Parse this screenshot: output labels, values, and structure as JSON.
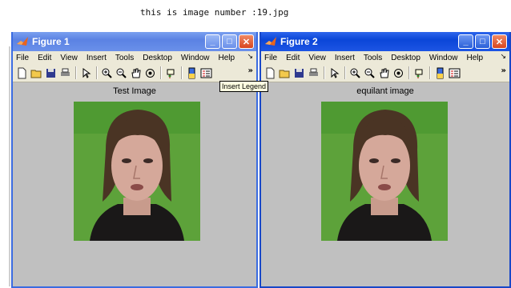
{
  "console": {
    "line": "this is image number :19.jpg"
  },
  "figures": [
    {
      "title": "Figure 1",
      "menus": [
        "File",
        "Edit",
        "View",
        "Insert",
        "Tools",
        "Desktop",
        "Window",
        "Help"
      ],
      "axes_title": "Test Image"
    },
    {
      "title": "Figure 2",
      "menus": [
        "File",
        "Edit",
        "View",
        "Insert",
        "Tools",
        "Desktop",
        "Window",
        "Help"
      ],
      "axes_title": "equilant image"
    }
  ],
  "tooltip": {
    "text": "Insert Legend"
  },
  "colors": {
    "photo_background": "#5da23a",
    "active_title": "#0b46d8",
    "inactive_title": "#6a90ea",
    "panel": "#c0c0c0"
  }
}
